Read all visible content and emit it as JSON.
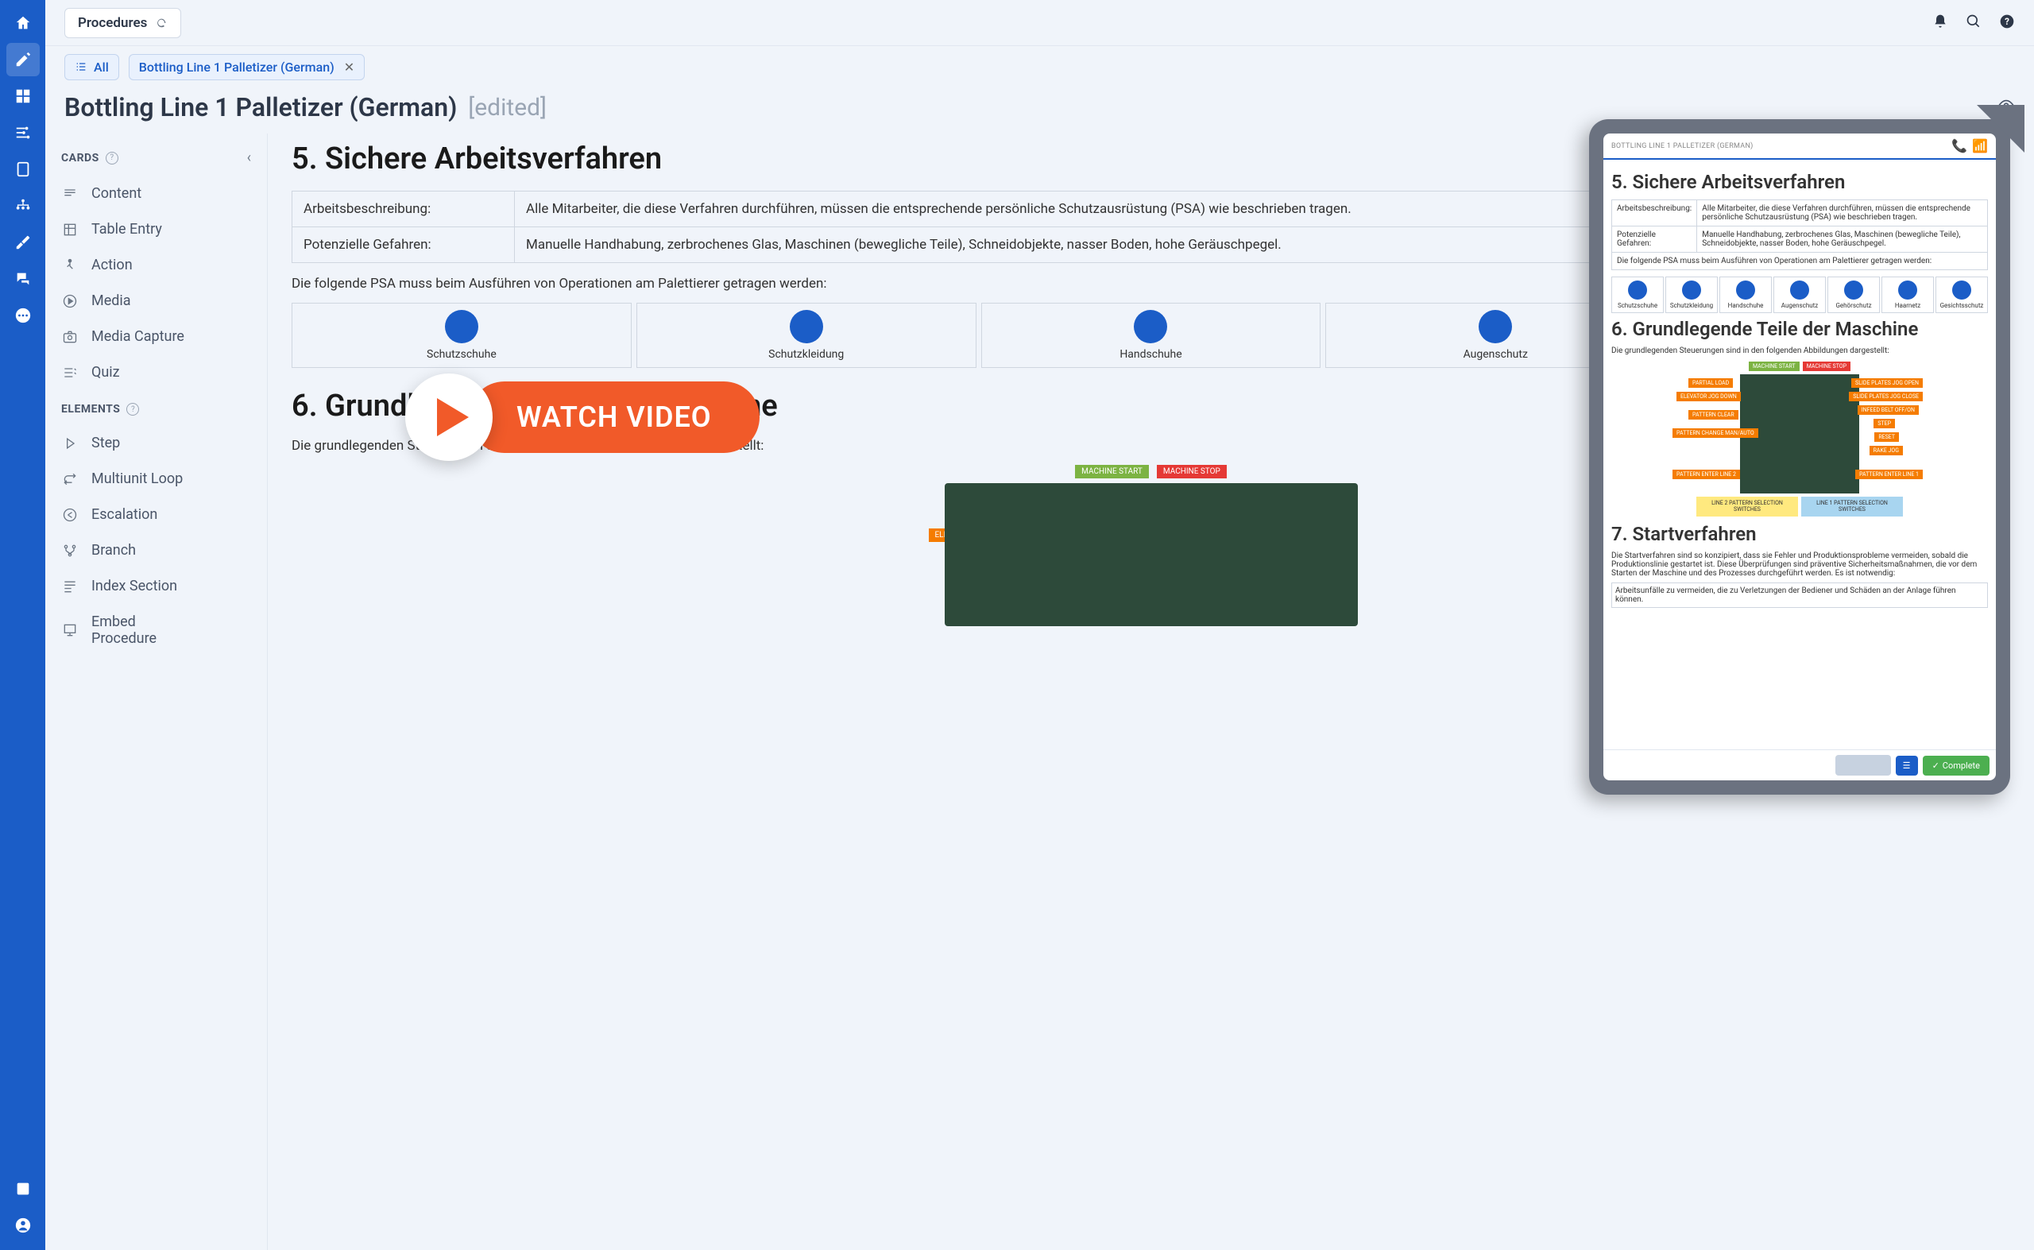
{
  "topbar": {
    "procedures_label": "Procedures"
  },
  "tabs": {
    "all_label": "All",
    "doc_label": "Bottling Line 1 Palletizer (German)"
  },
  "title": {
    "text": "Bottling Line 1 Palletizer (German)",
    "edited": "[edited]"
  },
  "panel": {
    "cards_header": "CARDS",
    "elements_header": "ELEMENTS",
    "cards": [
      "Content",
      "Table Entry",
      "Action",
      "Media",
      "Media Capture",
      "Quiz"
    ],
    "elements": [
      "Step",
      "Multiunit Loop",
      "Escalation",
      "Branch",
      "Index Section",
      "Embed\nProcedure"
    ]
  },
  "doc": {
    "s5_title": "5. Sichere Arbeitsverfahren",
    "s5_rows": [
      [
        "Arbeitsbeschreibung:",
        "Alle Mitarbeiter, die diese Verfahren durchführen, müssen die entsprechende persönliche Schutzausrüstung (PSA) wie beschrieben tragen."
      ],
      [
        "Potenzielle Gefahren:",
        "Manuelle Handhabung, zerbrochenes Glas, Maschinen (bewegliche Teile), Schneidobjekte, nasser Boden, hohe Geräuschpegel."
      ]
    ],
    "s5_psa": "Die folgende PSA muss beim Ausführen von Operationen am Palettierer getragen werden:",
    "ppe": [
      "Schutzschuhe",
      "Schutzkleidung",
      "Handschuhe",
      "Augenschutz",
      "Gehörschutz",
      "Haarnetz",
      "Gesichtsschutz"
    ],
    "s6_title": "6. Grundlegende Teile der Maschine",
    "s6_p": "Die grundlegenden Steuerungen sind in den folgenden Abbildungen dargestellt:",
    "ctrl_tags": {
      "machine_start": "MACHINE START",
      "machine_stop": "MACHINE STOP",
      "partial_load": "PARTIAL LOAD",
      "elevator": "ELEVATOR JOG DOWN",
      "pattern_clear": "PATTERN CLEAR",
      "pattern_change": "PATTERN CHANGE MAN/AUTO",
      "pattern_enter2": "PATTERN ENTER LINE 2",
      "slide_open": "SLIDE PLATES JOG OPEN",
      "slide_close": "SLIDE PLATES JOG CLOSE",
      "infeed": "INFEED BELT OFF/ON",
      "step": "STEP",
      "reset": "RESET",
      "rake": "RAKE JOG",
      "pattern_enter1": "PATTERN ENTER LINE 1",
      "sel1": "LINE 1 PATTERN SELECTION SWITCHES",
      "sel2": "LINE 2 PATTERN SELECTION SWITCHES"
    },
    "s7_title": "7. Startverfahren",
    "s7_p": "Die Startverfahren sind so konzipiert, dass sie Fehler und Produktionsprobleme vermeiden, sobald die Produktionslinie gestartet ist. Diese Überprüfungen sind präventive Sicherheitsmaßnahmen, die vor dem Starten der Maschine und des Prozesses durchgeführt werden. Es ist notwendig:",
    "s7_li": "Arbeitsunfälle zu vermeiden, die zu Verletzungen der Bediener und Schäden an der Anlage führen können."
  },
  "tablet": {
    "title": "BOTTLING LINE 1 PALLETIZER (GERMAN)",
    "complete": "Complete"
  },
  "watch_video": "WATCH VIDEO"
}
